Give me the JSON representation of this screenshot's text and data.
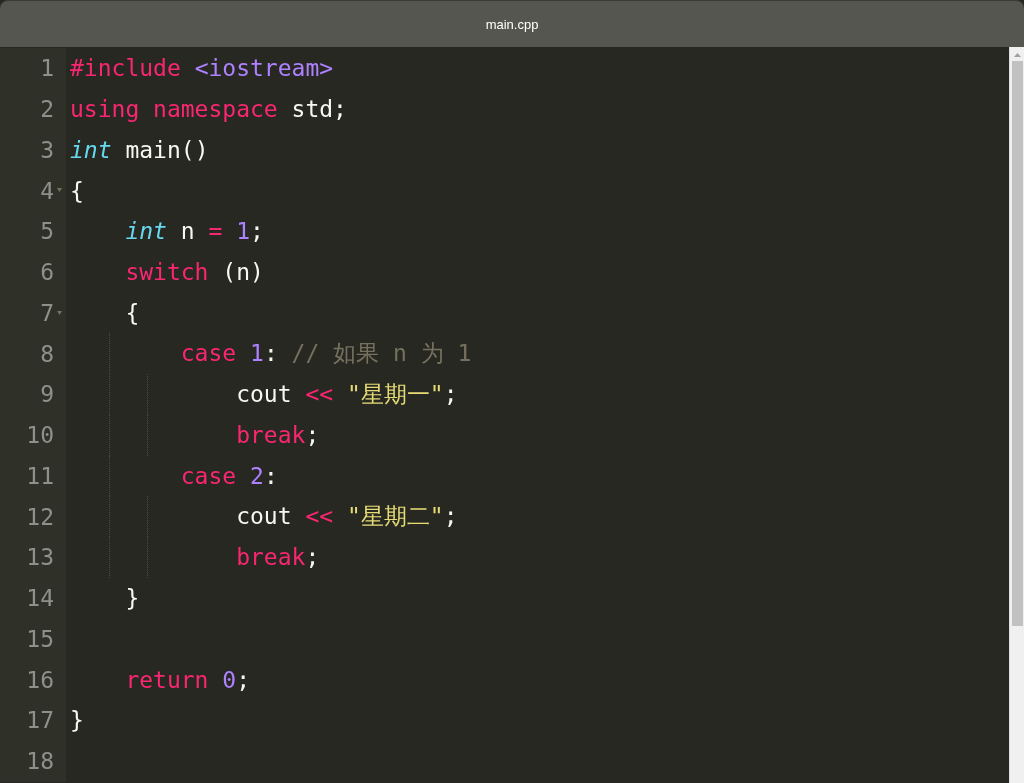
{
  "window": {
    "title": "main.cpp"
  },
  "editor": {
    "lines": [
      {
        "number": "1",
        "foldable": false,
        "tokens": [
          {
            "kind": "keyword",
            "text": "#include"
          },
          {
            "kind": "number",
            "text": " <iostream>"
          }
        ]
      },
      {
        "number": "2",
        "foldable": false,
        "tokens": [
          {
            "kind": "keyword",
            "text": "using namespace"
          },
          {
            "kind": "plain",
            "text": " std;"
          }
        ]
      },
      {
        "number": "3",
        "foldable": false,
        "tokens": [
          {
            "kind": "type",
            "text": "int"
          },
          {
            "kind": "plain",
            "text": " main()"
          }
        ]
      },
      {
        "number": "4",
        "foldable": true,
        "tokens": [
          {
            "kind": "plain",
            "text": "{"
          }
        ]
      },
      {
        "number": "5",
        "foldable": false,
        "tokens": [
          {
            "kind": "type",
            "text": "    int"
          },
          {
            "kind": "plain",
            "text": " n "
          },
          {
            "kind": "keyword",
            "text": "="
          },
          {
            "kind": "number",
            "text": " 1"
          },
          {
            "kind": "plain",
            "text": ";"
          }
        ]
      },
      {
        "number": "6",
        "foldable": false,
        "tokens": [
          {
            "kind": "keyword",
            "text": "    switch"
          },
          {
            "kind": "plain",
            "text": " (n)"
          }
        ]
      },
      {
        "number": "7",
        "foldable": true,
        "tokens": [
          {
            "kind": "plain",
            "text": "    {"
          }
        ]
      },
      {
        "number": "8",
        "foldable": false,
        "tokens": [
          {
            "kind": "keyword",
            "text": "        case"
          },
          {
            "kind": "number",
            "text": " 1"
          },
          {
            "kind": "plain",
            "text": ": "
          },
          {
            "kind": "comment",
            "text": "// 如果 n 为 1"
          }
        ]
      },
      {
        "number": "9",
        "foldable": false,
        "tokens": [
          {
            "kind": "plain",
            "text": "            cout "
          },
          {
            "kind": "keyword",
            "text": "<<"
          },
          {
            "kind": "string",
            "text": " \"星期一\""
          },
          {
            "kind": "plain",
            "text": ";"
          }
        ]
      },
      {
        "number": "10",
        "foldable": false,
        "tokens": [
          {
            "kind": "keyword",
            "text": "            break"
          },
          {
            "kind": "plain",
            "text": ";"
          }
        ]
      },
      {
        "number": "11",
        "foldable": false,
        "tokens": [
          {
            "kind": "keyword",
            "text": "        case"
          },
          {
            "kind": "number",
            "text": " 2"
          },
          {
            "kind": "plain",
            "text": ":"
          }
        ]
      },
      {
        "number": "12",
        "foldable": false,
        "tokens": [
          {
            "kind": "plain",
            "text": "            cout "
          },
          {
            "kind": "keyword",
            "text": "<<"
          },
          {
            "kind": "string",
            "text": " \"星期二\""
          },
          {
            "kind": "plain",
            "text": ";"
          }
        ]
      },
      {
        "number": "13",
        "foldable": false,
        "tokens": [
          {
            "kind": "keyword",
            "text": "            break"
          },
          {
            "kind": "plain",
            "text": ";"
          }
        ]
      },
      {
        "number": "14",
        "foldable": false,
        "tokens": [
          {
            "kind": "plain",
            "text": "    }"
          }
        ]
      },
      {
        "number": "15",
        "foldable": false
      },
      {
        "number": "16",
        "foldable": false,
        "tokens": [
          {
            "kind": "keyword",
            "text": "    return"
          },
          {
            "kind": "number",
            "text": " 0"
          },
          {
            "kind": "plain",
            "text": ";"
          }
        ]
      },
      {
        "number": "17",
        "foldable": false,
        "tokens": [
          {
            "kind": "plain",
            "text": "}"
          }
        ]
      },
      {
        "number": "18",
        "foldable": false
      }
    ]
  }
}
